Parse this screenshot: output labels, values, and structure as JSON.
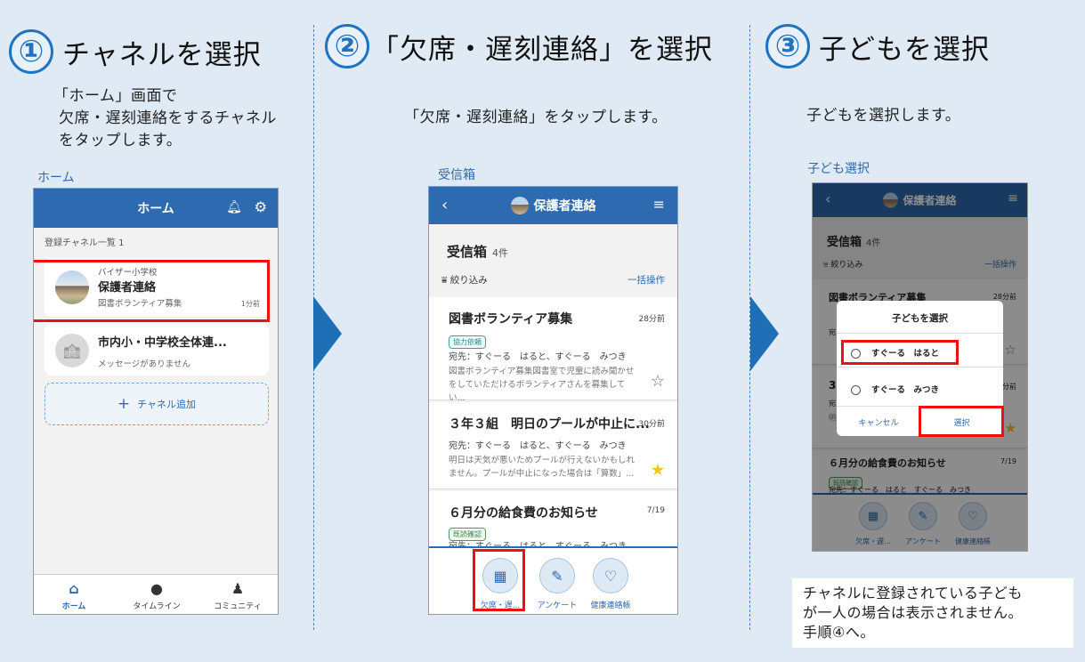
{
  "steps": [
    {
      "num": "①",
      "title": "チャネルを選択",
      "desc_lines": [
        "「ホーム」画面で",
        "欠席・遅刻連絡をするチャネル",
        "をタップします。"
      ],
      "caption": "ホーム"
    },
    {
      "num": "②",
      "title": "「欠席・遅刻連絡」を選択",
      "desc_lines": [
        "「欠席・遅刻連絡」をタップします。"
      ],
      "caption": "受信箱"
    },
    {
      "num": "③",
      "title": "子どもを選択",
      "desc_lines": [
        "子どもを選択します。"
      ],
      "caption": "子ども選択"
    }
  ],
  "phone1": {
    "header_title": "ホーム",
    "list_header": "登録チャネル一覧 1",
    "channels": [
      {
        "school": "バイザー小学校",
        "name": "保護者連絡",
        "preview": "図書ボランティア募集",
        "time": "1分前"
      },
      {
        "school": "",
        "name": "市内小・中学校全体連...",
        "preview": "メッセージがありません",
        "time": ""
      }
    ],
    "add_channel": "チャネル追加",
    "tabs": [
      "ホーム",
      "タイムライン",
      "コミュニティ"
    ]
  },
  "phone2": {
    "header_title": "保護者連絡",
    "inbox_title": "受信箱",
    "inbox_count": "4件",
    "filter": "絞り込み",
    "bulk": "一括操作",
    "messages": [
      {
        "title": "図書ボランティア募集",
        "time": "28分前",
        "tag": "協力依頼",
        "to": "宛先：すぐーる　はると、すぐーる　みつき",
        "body": "図書ボランティア募集図書室で児童に読み聞かせをしていただけるボランティアさんを募集してい..."
      },
      {
        "title": "３年３組　明日のプールが中止に...",
        "time": "30分前",
        "tag": "",
        "to": "宛先：すぐーる　はると、すぐーる　みつき",
        "body": "明日は天気が悪いためプールが行えないかもしれません。プールが中止になった場合は「算数」..."
      },
      {
        "title": "６月分の給食費のお知らせ",
        "time": "7/19",
        "tag": "既読確認",
        "to": "宛先：すぐーる　はると　すぐーる　みつき",
        "body": ""
      }
    ],
    "features": [
      "欠席・遅...",
      "アンケート",
      "健康連絡帳"
    ]
  },
  "phone3": {
    "header_title": "保護者連絡",
    "inbox_title": "受信箱",
    "inbox_count": "4件",
    "filter": "絞り込み",
    "bulk": "一括操作",
    "msg1_title": "図書ボランティア募集",
    "msg1_time": "28分前",
    "msg1_to": "宛",
    "msg2_title": "3",
    "msg2_time": "0分前",
    "msg2_to": "宛",
    "msg2_body": "明",
    "msg3_title": "６月分の給食費のお知らせ",
    "msg3_time": "7/19",
    "msg3_tag": "既読確認",
    "msg3_to": "宛先：すぐーる　はると　すぐーる　みつき",
    "dialog_title": "子どもを選択",
    "options": [
      "すぐーる　はると",
      "すぐーる　みつき"
    ],
    "cancel": "キャンセル",
    "select": "選択",
    "features": [
      "欠席・遅...",
      "アンケート",
      "健康連絡帳"
    ]
  },
  "note_lines": [
    "チャネルに登録されている子ども",
    "が一人の場合は表示されません。",
    "手順④へ。"
  ]
}
